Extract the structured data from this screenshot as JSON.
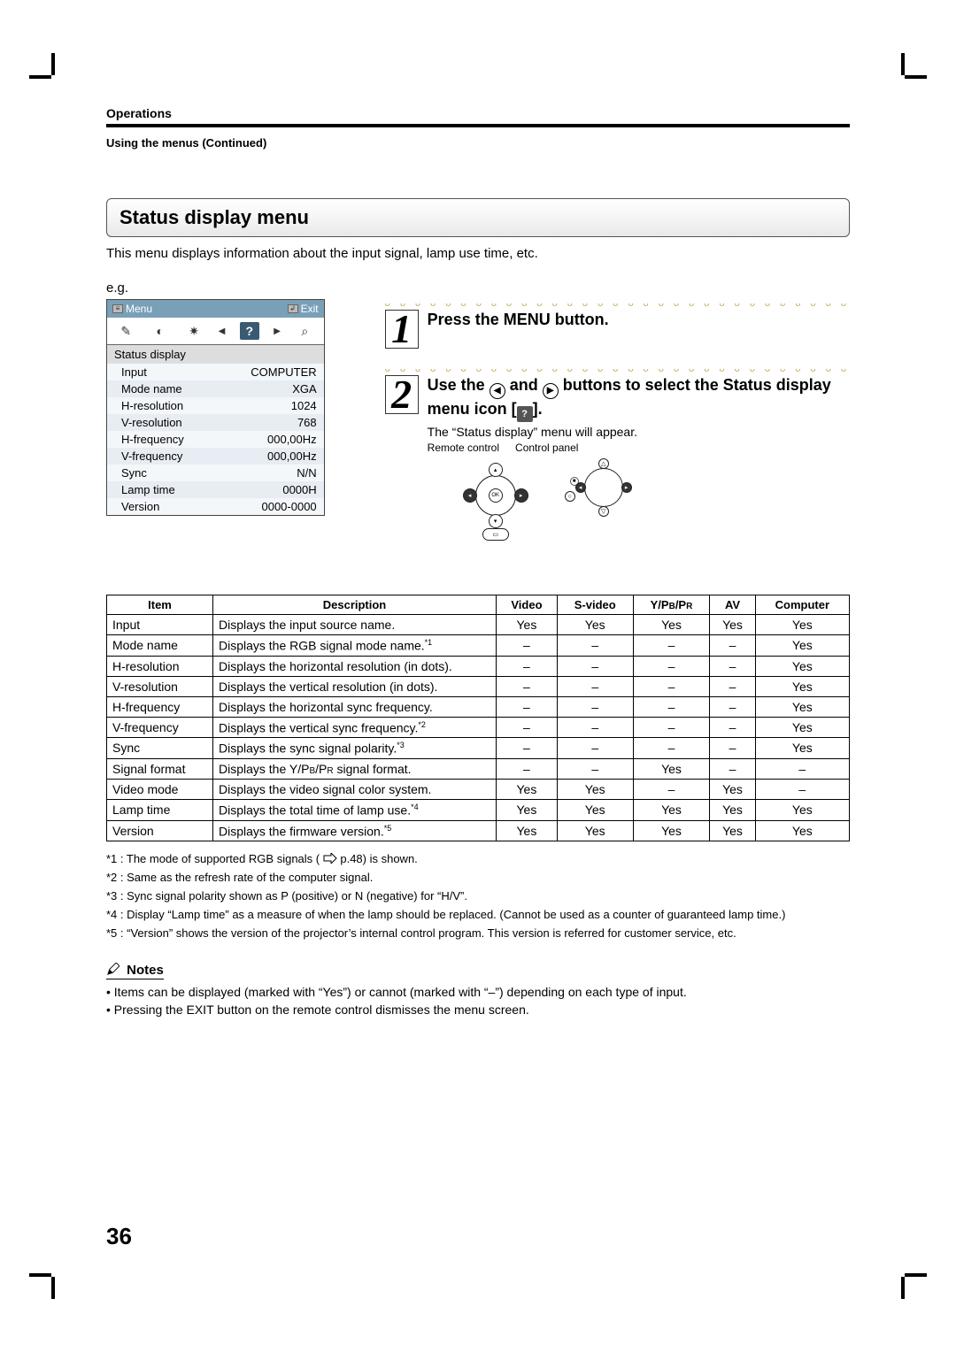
{
  "header": {
    "section": "Operations",
    "subsection": "Using the menus (Continued)"
  },
  "title": "Status display menu",
  "intro": "This menu displays information about the input signal, lamp use time, etc.",
  "eg": "e.g.",
  "menuPanel": {
    "menuLabel": "Menu",
    "exitLabel": "Exit",
    "heading": "Status display",
    "rows": [
      {
        "k": "Input",
        "v": "COMPUTER"
      },
      {
        "k": "Mode name",
        "v": "XGA"
      },
      {
        "k": "H-resolution",
        "v": "1024"
      },
      {
        "k": "V-resolution",
        "v": "768"
      },
      {
        "k": "H-frequency",
        "v": "000,00Hz"
      },
      {
        "k": "V-frequency",
        "v": "000,00Hz"
      },
      {
        "k": "Sync",
        "v": "N/N"
      },
      {
        "k": "Lamp time",
        "v": "0000H"
      },
      {
        "k": "Version",
        "v": "0000-0000"
      }
    ]
  },
  "steps": {
    "s1": {
      "num": "1",
      "title": "Press the MENU button."
    },
    "s2": {
      "num": "2",
      "t1": "Use the ",
      "t2": " and ",
      "t3": " buttons to select the Status display menu icon [",
      "t4": "].",
      "appear": "The “Status display” menu will appear.",
      "rcLabel": "Remote control",
      "cpLabel": "Control panel"
    }
  },
  "table": {
    "head": [
      "Item",
      "Description",
      "Video",
      "S-video",
      "Y/Pʙ/Pʀ",
      "AV",
      "Computer"
    ],
    "rows": [
      [
        "Input",
        "Displays the input source name.",
        "Yes",
        "Yes",
        "Yes",
        "Yes",
        "Yes",
        ""
      ],
      [
        "Mode name",
        "Displays the RGB signal mode name.",
        "–",
        "–",
        "–",
        "–",
        "Yes",
        "*1"
      ],
      [
        "H-resolution",
        "Displays the horizontal resolution (in dots).",
        "–",
        "–",
        "–",
        "–",
        "Yes",
        ""
      ],
      [
        "V-resolution",
        "Displays the vertical resolution (in dots).",
        "–",
        "–",
        "–",
        "–",
        "Yes",
        ""
      ],
      [
        "H-frequency",
        "Displays the horizontal sync frequency.",
        "–",
        "–",
        "–",
        "–",
        "Yes",
        ""
      ],
      [
        "V-frequency",
        "Displays the vertical sync frequency.",
        "–",
        "–",
        "–",
        "–",
        "Yes",
        "*2"
      ],
      [
        "Sync",
        "Displays the sync signal polarity.",
        "–",
        "–",
        "–",
        "–",
        "Yes",
        "*3"
      ],
      [
        "Signal format",
        "Displays the Y/Pʙ/Pʀ signal format.",
        "–",
        "–",
        "Yes",
        "–",
        "–",
        ""
      ],
      [
        "Video mode",
        "Displays the video signal color system.",
        "Yes",
        "Yes",
        "–",
        "Yes",
        "–",
        ""
      ],
      [
        "Lamp time",
        "Displays the total time of lamp use.",
        "Yes",
        "Yes",
        "Yes",
        "Yes",
        "Yes",
        "*4"
      ],
      [
        "Version",
        "Displays the firmware version.",
        "Yes",
        "Yes",
        "Yes",
        "Yes",
        "Yes",
        "*5"
      ]
    ]
  },
  "footnotes": {
    "f1a": "*1 : The mode of supported RGB signals (",
    "f1b": " p.48) is shown.",
    "f2": "*2 : Same as the refresh rate of the computer signal.",
    "f3": "*3 : Sync signal polarity shown as P (positive) or N (negative) for “H/V”.",
    "f4": "*4 : Display “Lamp time” as a measure of when the lamp should be replaced. (Cannot be used as a counter of guaranteed lamp time.)",
    "f5": "*5 : “Version” shows the version of the projector’s internal control program. This version is referred for customer service, etc."
  },
  "notes": {
    "title": "Notes",
    "n1": "• Items can be displayed (marked with “Yes”) or cannot (marked with “–”) depending on each type of input.",
    "n2": "• Pressing the EXIT button on the remote control dismisses the menu screen."
  },
  "pageNumber": "36"
}
